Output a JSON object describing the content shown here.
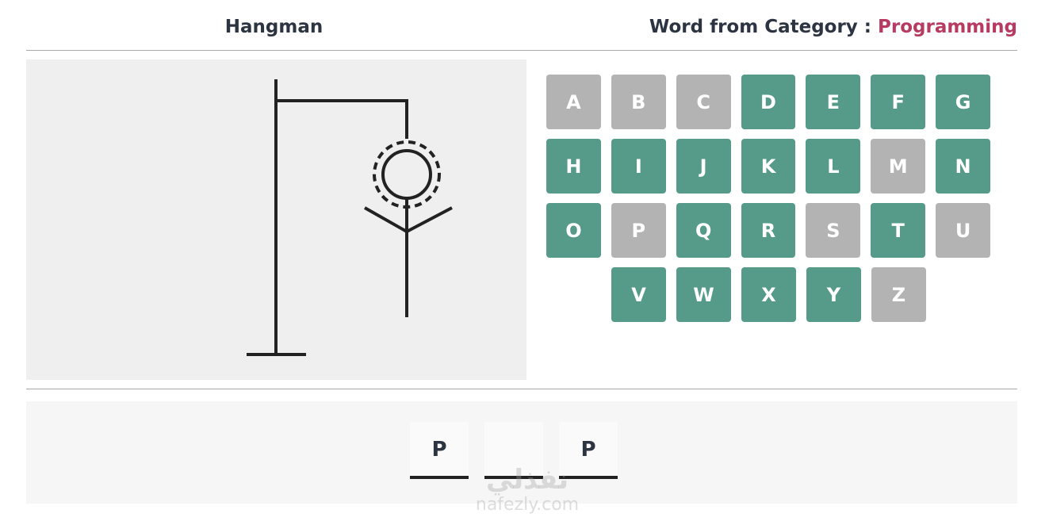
{
  "header": {
    "title": "Hangman",
    "category_label": "Word from Category : ",
    "category_value": "Programming"
  },
  "keyboard": {
    "rows": [
      [
        {
          "letter": "A",
          "state": "used"
        },
        {
          "letter": "B",
          "state": "used"
        },
        {
          "letter": "C",
          "state": "used"
        },
        {
          "letter": "D",
          "state": "available"
        },
        {
          "letter": "E",
          "state": "available"
        },
        {
          "letter": "F",
          "state": "available"
        },
        {
          "letter": "G",
          "state": "available"
        }
      ],
      [
        {
          "letter": "H",
          "state": "available"
        },
        {
          "letter": "I",
          "state": "available"
        },
        {
          "letter": "J",
          "state": "available"
        },
        {
          "letter": "K",
          "state": "available"
        },
        {
          "letter": "L",
          "state": "available"
        },
        {
          "letter": "M",
          "state": "used"
        },
        {
          "letter": "N",
          "state": "available"
        }
      ],
      [
        {
          "letter": "O",
          "state": "available"
        },
        {
          "letter": "P",
          "state": "used"
        },
        {
          "letter": "Q",
          "state": "available"
        },
        {
          "letter": "R",
          "state": "available"
        },
        {
          "letter": "S",
          "state": "used"
        },
        {
          "letter": "T",
          "state": "available"
        },
        {
          "letter": "U",
          "state": "used"
        }
      ],
      [
        {
          "letter": "V",
          "state": "available"
        },
        {
          "letter": "W",
          "state": "available"
        },
        {
          "letter": "X",
          "state": "available"
        },
        {
          "letter": "Y",
          "state": "available"
        },
        {
          "letter": "Z",
          "state": "used"
        }
      ]
    ]
  },
  "word": {
    "slots": [
      "P",
      "",
      "P"
    ]
  },
  "hangman": {
    "parts_shown": [
      "base",
      "pole",
      "beam",
      "rope",
      "head",
      "body",
      "arms"
    ]
  },
  "watermark": {
    "arabic": "نفذلي",
    "latin": "nafezly.com"
  },
  "colors": {
    "available_key": "#569b89",
    "used_key": "#b3b3b3",
    "category_accent": "#b73a62",
    "text": "#2c3442"
  }
}
